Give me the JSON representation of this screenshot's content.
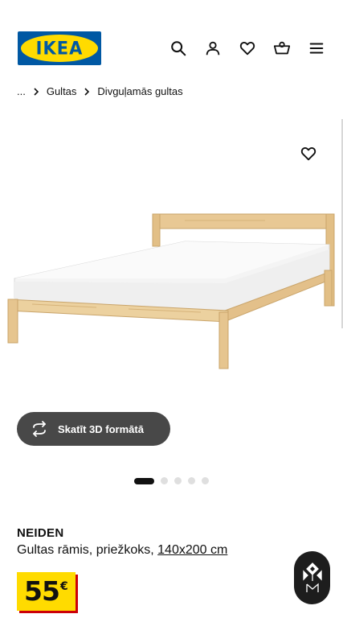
{
  "header": {
    "logo_text": "IKEA",
    "icons": [
      "search-icon",
      "user-icon",
      "heart-icon",
      "cart-icon",
      "menu-icon"
    ]
  },
  "breadcrumb": {
    "items": [
      "...",
      "Gultas",
      "Divguļamās gultas"
    ]
  },
  "gallery": {
    "view_3d_label": "Skatīt 3D formātā",
    "dot_count": 5,
    "active_index": 0
  },
  "product": {
    "name": "NEIDEN",
    "description": "Gultas rāmis, priežkoks, ",
    "size": "140x200 cm",
    "price_integer": "55",
    "price_currency": "€"
  },
  "colors": {
    "ikea_blue": "#0058a3",
    "ikea_yellow": "#ffdb00",
    "price_shadow": "#cc0008",
    "button_dark": "#484848"
  }
}
